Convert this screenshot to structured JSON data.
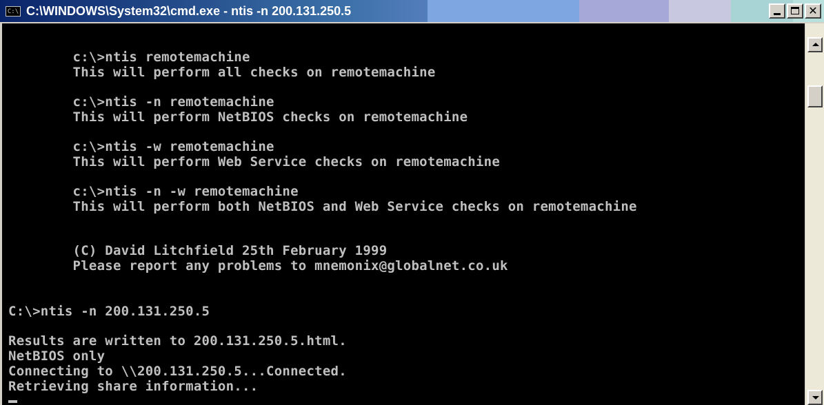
{
  "window": {
    "title": "C:\\WINDOWS\\System32\\cmd.exe - ntis -n 200.131.250.5",
    "icon_label": "C:\\",
    "colors": {
      "titlebar_start": "#0a246a",
      "titlebar_end": "#a6caf0",
      "console_bg": "#000000",
      "console_text": "#c0c0c0",
      "chrome": "#d4d0c8"
    },
    "title_swatches": [
      "#7ea6e0",
      "#a6a9d8",
      "#c8c8e0",
      "#a8d4d6",
      "#b8e0dc"
    ]
  },
  "controls": {
    "minimize_icon": "minimize-icon",
    "maximize_icon": "maximize-icon",
    "close_icon": "close-icon",
    "close_glyph": "✕"
  },
  "console": {
    "lines": [
      "        c:\\>ntis remotemachine",
      "        This will perform all checks on remotemachine",
      "        c:\\>ntis -n remotemachine",
      "        This will perform NetBIOS checks on remotemachine",
      "        c:\\>ntis -w remotemachine",
      "        This will perform Web Service checks on remotemachine",
      "        c:\\>ntis -n -w remotemachine",
      "        This will perform both NetBIOS and Web Service checks on remotemachine",
      "        (C) David Litchfield 25th February 1999",
      "        Please report any problems to mnemonix@globalnet.co.uk",
      "C:\\>ntis -n 200.131.250.5",
      "Results are written to 200.131.250.5.html.",
      "NetBIOS only",
      "Connecting to \\\\200.131.250.5...Connected.",
      "Retrieving share information..."
    ]
  },
  "scrollbar": {
    "up_icon": "arrow-up-icon",
    "down_icon": "arrow-down-icon"
  }
}
